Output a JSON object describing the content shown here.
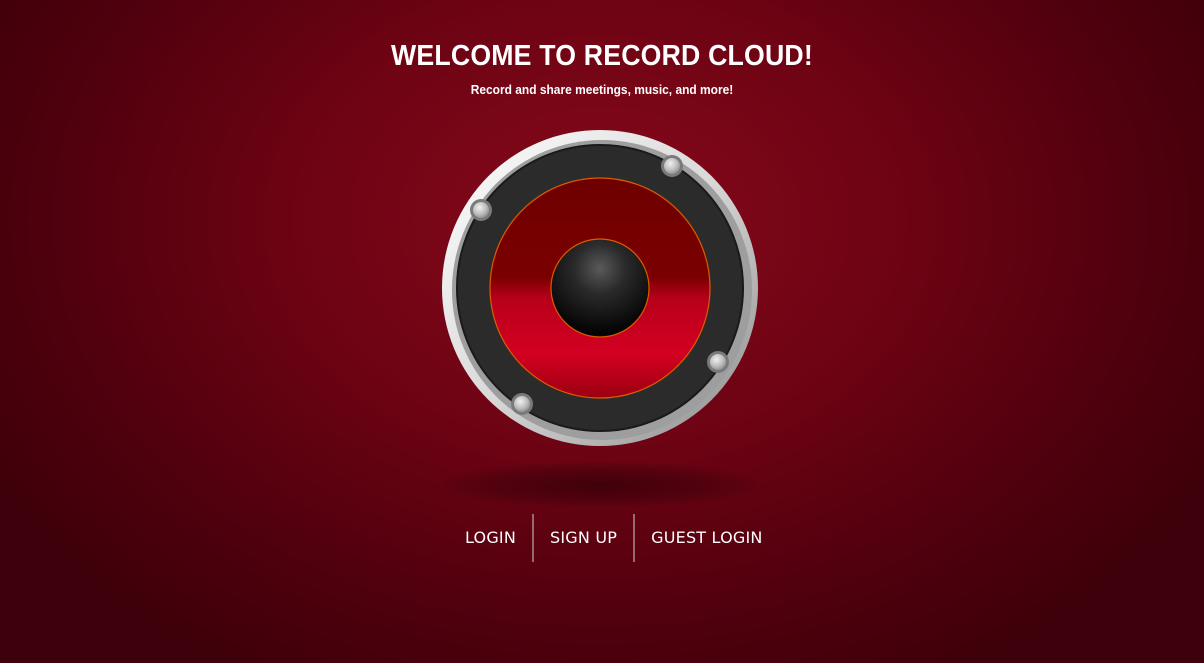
{
  "header": {
    "title": "WELCOME TO RECORD CLOUD!",
    "subtitle": "Record and share meetings, music, and more!"
  },
  "hero": {
    "icon": "speaker-icon",
    "colors": {
      "cone_red": "#d0001f",
      "cone_dark": "#7a0000",
      "rim": "#2b2b2b",
      "bezel": "#e6e6e6",
      "accent_ring": "#e05a00"
    }
  },
  "nav": {
    "items": [
      {
        "label": "LOGIN"
      },
      {
        "label": "SIGN UP"
      },
      {
        "label": "GUEST LOGIN"
      }
    ]
  },
  "theme": {
    "background": "#6c0313",
    "text": "#ffffff"
  }
}
